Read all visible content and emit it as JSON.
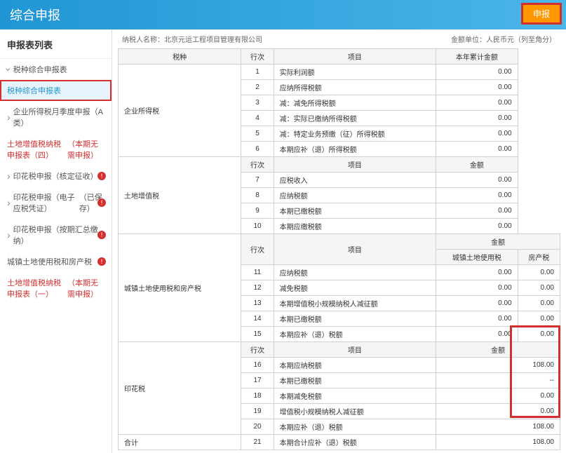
{
  "header": {
    "title": "综合申报",
    "submit_label": "申报"
  },
  "sidebar": {
    "title": "申报表列表",
    "group_label": "税种综合申报表",
    "items": [
      {
        "label": "税种综合申报表",
        "active": true
      },
      {
        "label": "企业所得税月季度申报（A类）",
        "chevron": true
      },
      {
        "label": "土地增值税纳税申报表（四）",
        "suffix": "（本期无需申报）",
        "warn": true
      },
      {
        "label": "印花税申报（核定征收）",
        "chevron": true,
        "badge": true
      },
      {
        "label": "印花税申报（电子应税凭证）",
        "suffix": "（已保存）",
        "chevron": true,
        "badge": true
      },
      {
        "label": "印花税申报（按期汇总缴纳）",
        "chevron": true,
        "badge": true
      },
      {
        "label": "城镇土地使用税和房产税",
        "badge": true
      },
      {
        "label": "土地增值税纳税申报表（一）",
        "suffix": "（本期无需申报）",
        "warn": true
      }
    ]
  },
  "top_info": {
    "left_label": "纳税人名称：",
    "left_value": "北京元运工程项目管理有限公司",
    "right": "金额单位：人民币元（列至角分）"
  },
  "tbl": {
    "h": {
      "tax": "税种",
      "row": "行次",
      "item": "项目",
      "ytd": "本年累计金额",
      "amount": "金额",
      "land": "城镇土地使用税",
      "house": "房产税"
    },
    "sec1": {
      "name": "企业所得税",
      "rows": [
        {
          "n": "1",
          "item": "实际利润额",
          "v": "0.00"
        },
        {
          "n": "2",
          "item": "应纳所得税额",
          "v": "0.00"
        },
        {
          "n": "3",
          "item": "减：减免所得税额",
          "v": "0.00"
        },
        {
          "n": "4",
          "item": "减：实际已缴纳所得税额",
          "v": "0.00"
        },
        {
          "n": "5",
          "item": "减：特定业务预缴（征）所得税额",
          "v": "0.00"
        },
        {
          "n": "6",
          "item": "本期应补（退）所得税额",
          "v": "0.00"
        }
      ]
    },
    "sec2": {
      "name": "土地增值税",
      "rows": [
        {
          "n": "7",
          "item": "应税收入",
          "v": "0.00"
        },
        {
          "n": "8",
          "item": "应纳税额",
          "v": "0.00"
        },
        {
          "n": "9",
          "item": "本期已缴税额",
          "v": "0.00"
        },
        {
          "n": "10",
          "item": "本期应缴税额",
          "v": "0.00"
        }
      ]
    },
    "sec3": {
      "name": "城镇土地使用税和房产税",
      "rows": [
        {
          "n": "11",
          "item": "应纳税额",
          "v1": "0.00",
          "v2": "0.00"
        },
        {
          "n": "12",
          "item": "减免税额",
          "v1": "0.00",
          "v2": "0.00"
        },
        {
          "n": "13",
          "item": "本期增值税小规模纳税人减征额",
          "v1": "0.00",
          "v2": "0.00"
        },
        {
          "n": "14",
          "item": "本期已缴税额",
          "v1": "0.00",
          "v2": "0.00"
        },
        {
          "n": "15",
          "item": "本期应补（退）税额",
          "v1": "0.00",
          "v2": "0.00"
        }
      ]
    },
    "sec4": {
      "name": "印花税",
      "rows": [
        {
          "n": "16",
          "item": "本期应纳税额",
          "v": "108.00"
        },
        {
          "n": "17",
          "item": "本期已缴税额",
          "v": "--"
        },
        {
          "n": "18",
          "item": "本期减免税额",
          "v": "0.00"
        },
        {
          "n": "19",
          "item": "增值税小规模纳税人减征额",
          "v": "0.00"
        },
        {
          "n": "20",
          "item": "本期应补（退）税额",
          "v": "108.00"
        }
      ]
    },
    "sec5": {
      "name": "合计",
      "rows": [
        {
          "n": "21",
          "item": "本期合计应补（退）税额",
          "v": "108.00"
        }
      ]
    }
  }
}
